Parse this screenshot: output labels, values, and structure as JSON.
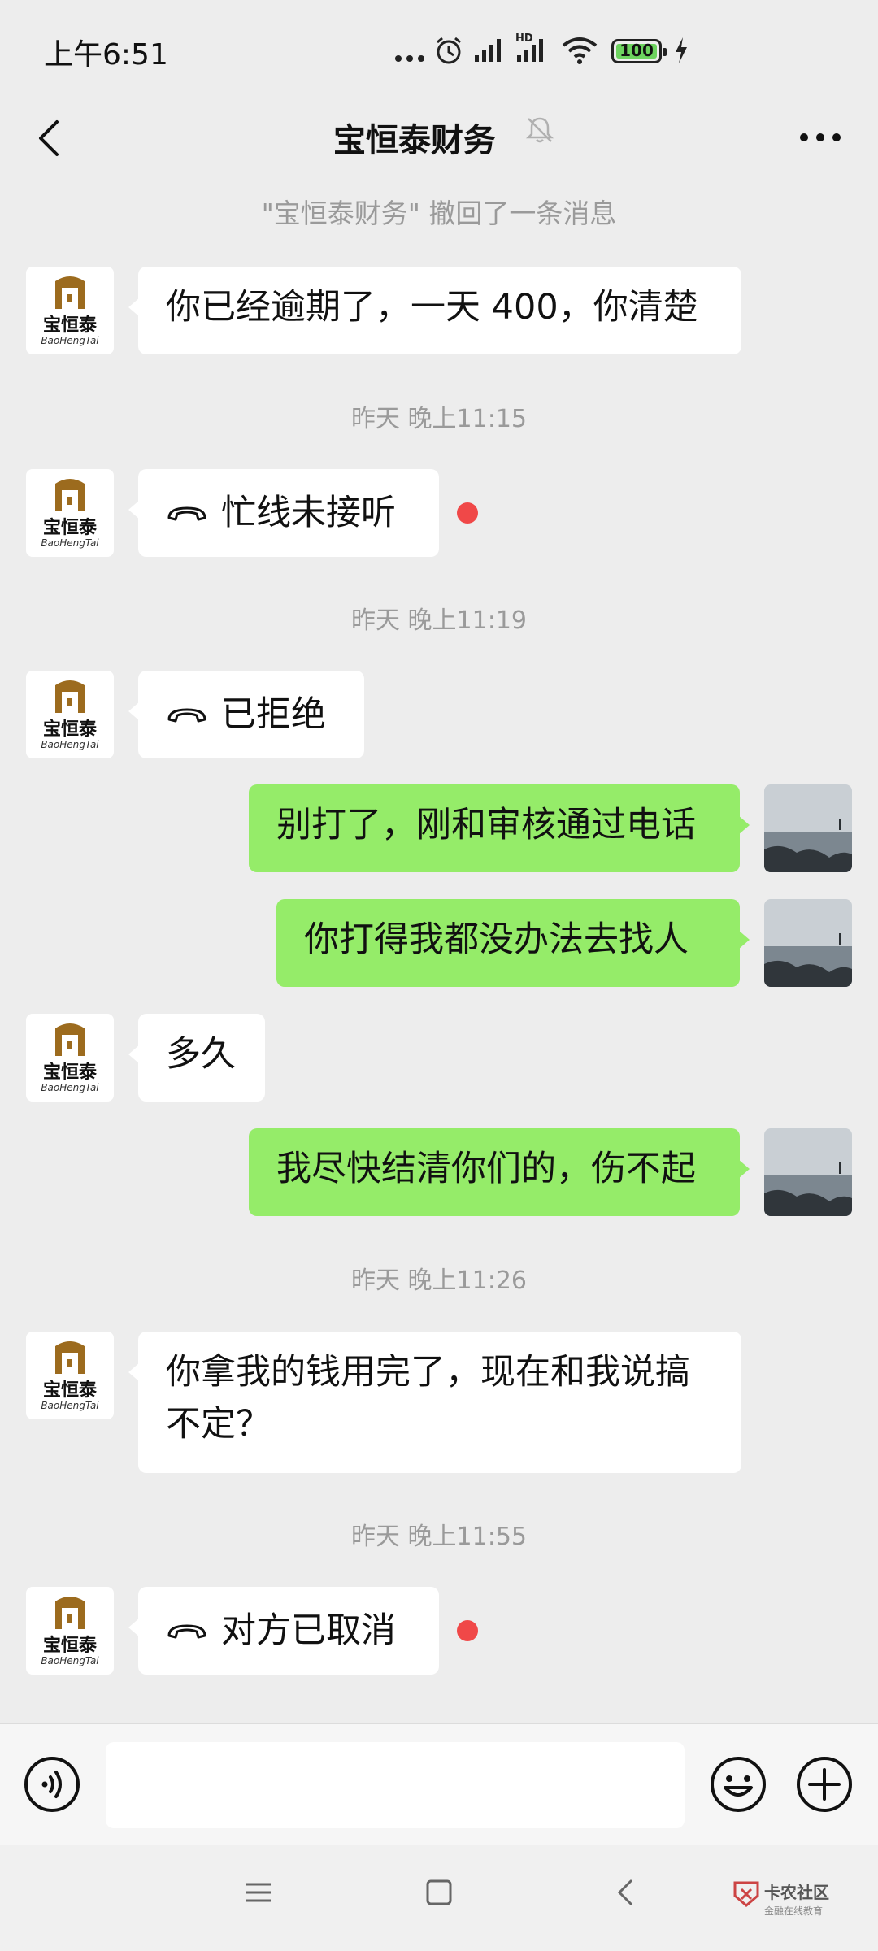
{
  "status_bar": {
    "time": "上午6:51",
    "battery": "100",
    "network_label": "HD"
  },
  "header": {
    "title": "宝恒泰财务"
  },
  "contact_avatar": {
    "name": "宝恒泰",
    "sub": "BaoHengTai"
  },
  "chat": {
    "recall_note": "\"宝恒泰财务\" 撤回了一条消息",
    "messages": [
      {
        "from": "them",
        "text": "你已经逾期了，一天 400，你清楚"
      },
      {
        "type": "time",
        "text": "昨天 晚上11:15"
      },
      {
        "from": "them",
        "call": true,
        "text": "忙线未接听",
        "unread": true
      },
      {
        "type": "time",
        "text": "昨天 晚上11:19"
      },
      {
        "from": "them",
        "call": true,
        "text": "已拒绝"
      },
      {
        "from": "me",
        "text": "别打了，刚和审核通过电话"
      },
      {
        "from": "me",
        "text": "你打得我都没办法去找人"
      },
      {
        "from": "them",
        "text": "多久"
      },
      {
        "from": "me",
        "text": "我尽快结清你们的，伤不起"
      },
      {
        "type": "time",
        "text": "昨天 晚上11:26"
      },
      {
        "from": "them",
        "text": "你拿我的钱用完了，现在和我说搞不定？"
      },
      {
        "type": "time",
        "text": "昨天 晚上11:55"
      },
      {
        "from": "them",
        "call": true,
        "text": "对方已取消",
        "unread": true
      }
    ]
  },
  "watermark": {
    "title": "卡农社区",
    "sub": "金融在线教育"
  },
  "icons": {
    "back": "chevron-left-icon",
    "mute": "bell-off-icon",
    "more": "more-icon",
    "voice": "voice-icon",
    "emoji": "emoji-icon",
    "plus": "plus-icon"
  }
}
